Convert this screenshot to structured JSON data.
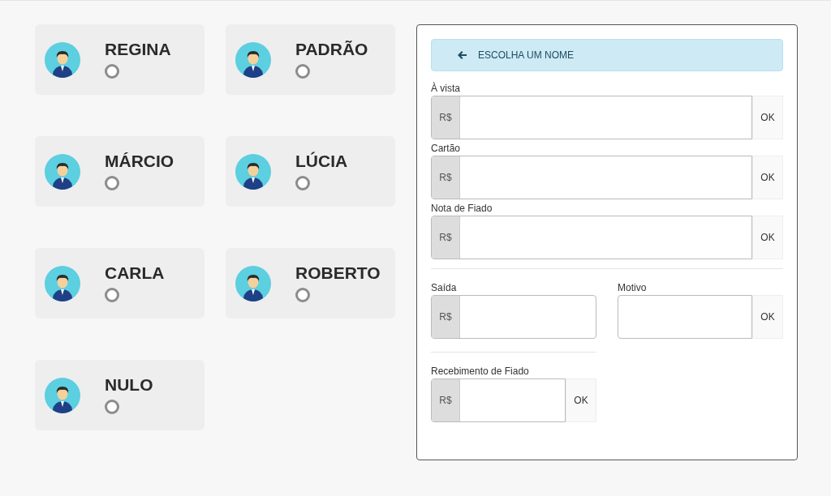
{
  "people": [
    {
      "name": "REGINA",
      "selected": false
    },
    {
      "name": "PADRÃO",
      "selected": false
    },
    {
      "name": "MÁRCIO",
      "selected": false
    },
    {
      "name": "LÚCIA",
      "selected": false
    },
    {
      "name": "CARLA",
      "selected": false
    },
    {
      "name": "ROBERTO",
      "selected": false
    },
    {
      "name": "NULO",
      "selected": false
    }
  ],
  "panel": {
    "banner": "ESCOLHA UM NOME",
    "fields": [
      {
        "label": "À vista",
        "prefix": "R$",
        "button": "OK"
      },
      {
        "label": "Cartão",
        "prefix": "R$",
        "button": "OK"
      },
      {
        "label": "Nota de Fiado",
        "prefix": "R$",
        "button": "OK"
      }
    ],
    "expense": {
      "amount": {
        "label": "Saída",
        "prefix": "R$"
      },
      "reason": {
        "label": "Motivo",
        "button": "OK"
      }
    },
    "receipt": {
      "label": "Recebimento de Fiado",
      "prefix": "R$",
      "button": "OK"
    }
  }
}
